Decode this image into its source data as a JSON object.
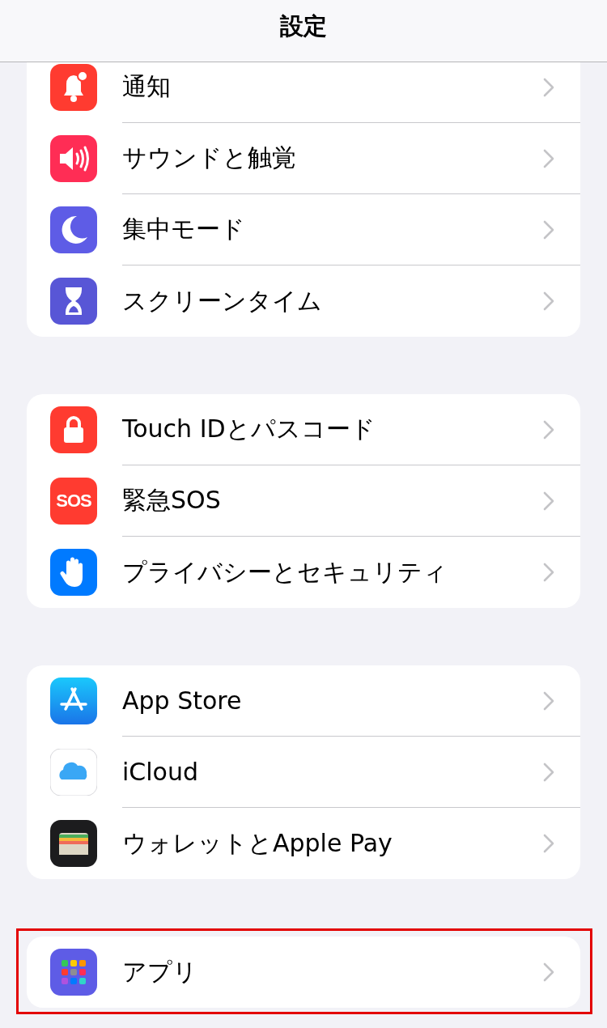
{
  "header": {
    "title": "設定"
  },
  "groups": [
    {
      "items": [
        {
          "label": "通知"
        },
        {
          "label": "サウンドと触覚"
        },
        {
          "label": "集中モード"
        },
        {
          "label": "スクリーンタイム"
        }
      ]
    },
    {
      "items": [
        {
          "label": "Touch IDとパスコード"
        },
        {
          "label": "緊急SOS",
          "icon_text": "SOS"
        },
        {
          "label": "プライバシーとセキュリティ"
        }
      ]
    },
    {
      "items": [
        {
          "label": "App Store"
        },
        {
          "label": "iCloud"
        },
        {
          "label": "ウォレットとApple Pay"
        }
      ]
    },
    {
      "highlighted": true,
      "items": [
        {
          "label": "アプリ"
        }
      ]
    }
  ]
}
